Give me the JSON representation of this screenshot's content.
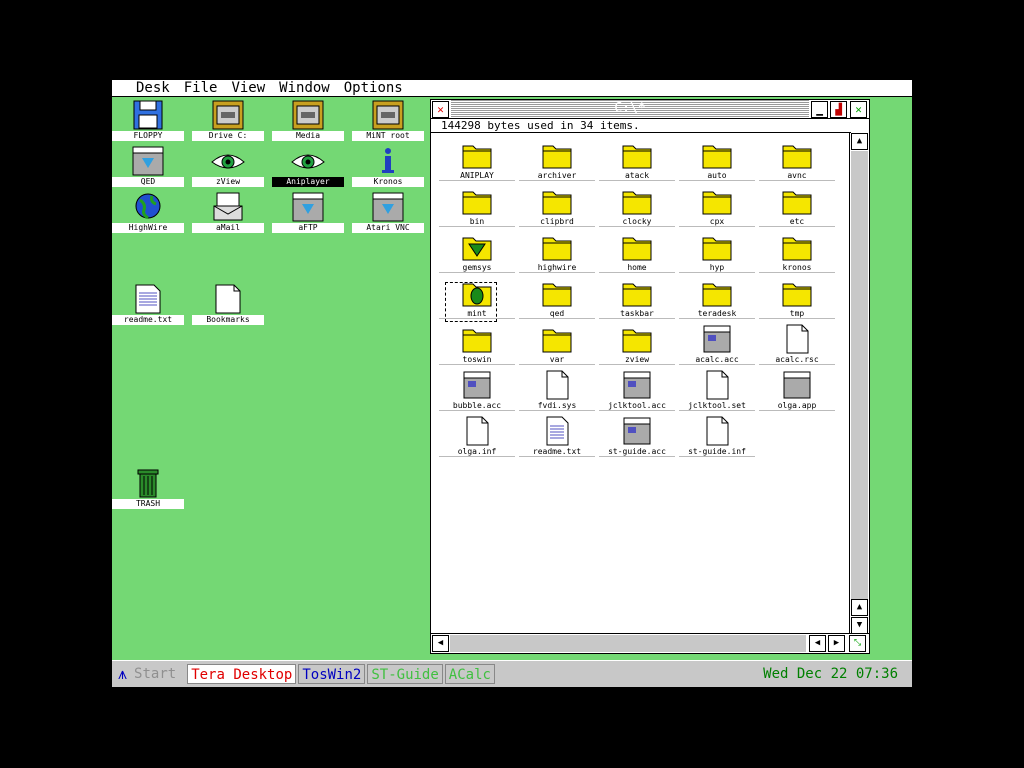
{
  "menubar": {
    "items": [
      "Desk",
      "File",
      "View",
      "Window",
      "Options"
    ]
  },
  "desktop": {
    "icons": [
      {
        "label": "FLOPPY",
        "icon": "floppy-drive-icon"
      },
      {
        "label": "Drive C:",
        "icon": "hard-drive-icon"
      },
      {
        "label": "Media",
        "icon": "media-drive-icon"
      },
      {
        "label": "MiNT root",
        "icon": "mint-root-drive-icon"
      },
      {
        "label": "QED",
        "icon": "qed-app-icon"
      },
      {
        "label": "zView",
        "icon": "eye-icon"
      },
      {
        "label": "Aniplayer",
        "icon": "eye-icon",
        "selected": true
      },
      {
        "label": "Kronos",
        "icon": "info-icon"
      },
      {
        "label": "HighWire",
        "icon": "globe-icon"
      },
      {
        "label": "aMail",
        "icon": "mail-icon"
      },
      {
        "label": "aFTP",
        "icon": "ftp-app-icon"
      },
      {
        "label": "Atari VNC",
        "icon": "vnc-app-icon"
      },
      {
        "label": "readme.txt",
        "icon": "text-file-icon"
      },
      {
        "label": "Bookmarks",
        "icon": "document-icon"
      },
      {
        "label": "TRASH",
        "icon": "trash-icon"
      }
    ]
  },
  "window": {
    "title": "C:\\*",
    "info": "144298 bytes used in 34 items.",
    "files": [
      {
        "name": "ANIPLAY",
        "type": "folder"
      },
      {
        "name": "archiver",
        "type": "folder"
      },
      {
        "name": "atack",
        "type": "folder"
      },
      {
        "name": "auto",
        "type": "folder"
      },
      {
        "name": "avnc",
        "type": "folder"
      },
      {
        "name": "bin",
        "type": "folder"
      },
      {
        "name": "clipbrd",
        "type": "folder"
      },
      {
        "name": "clocky",
        "type": "folder"
      },
      {
        "name": "cpx",
        "type": "folder"
      },
      {
        "name": "etc",
        "type": "folder"
      },
      {
        "name": "gemsys",
        "type": "folder-special"
      },
      {
        "name": "highwire",
        "type": "folder"
      },
      {
        "name": "home",
        "type": "folder"
      },
      {
        "name": "hyp",
        "type": "folder"
      },
      {
        "name": "kronos",
        "type": "folder"
      },
      {
        "name": "mint",
        "type": "folder-leaf"
      },
      {
        "name": "qed",
        "type": "folder"
      },
      {
        "name": "taskbar",
        "type": "folder"
      },
      {
        "name": "teradesk",
        "type": "folder"
      },
      {
        "name": "tmp",
        "type": "folder"
      },
      {
        "name": "toswin",
        "type": "folder"
      },
      {
        "name": "var",
        "type": "folder"
      },
      {
        "name": "zview",
        "type": "folder"
      },
      {
        "name": "acalc.acc",
        "type": "app"
      },
      {
        "name": "acalc.rsc",
        "type": "doc"
      },
      {
        "name": "bubble.acc",
        "type": "app"
      },
      {
        "name": "fvdi.sys",
        "type": "doc"
      },
      {
        "name": "jclktool.acc",
        "type": "app"
      },
      {
        "name": "jclktool.set",
        "type": "doc"
      },
      {
        "name": "olga.app",
        "type": "app-plain"
      },
      {
        "name": "olga.inf",
        "type": "doc"
      },
      {
        "name": "readme.txt",
        "type": "text"
      },
      {
        "name": "st-guide.acc",
        "type": "app"
      },
      {
        "name": "st-guide.inf",
        "type": "doc"
      }
    ]
  },
  "taskbar": {
    "start_label": "Start",
    "tasks": [
      {
        "label": "Tera Desktop",
        "color": "#e00000"
      },
      {
        "label": "TosWin2",
        "color": "#0000c0"
      },
      {
        "label": "ST-Guide",
        "color": "#40c040"
      },
      {
        "label": "ACalc",
        "color": "#40c040"
      }
    ],
    "clock": "Wed Dec 22 07:36"
  }
}
